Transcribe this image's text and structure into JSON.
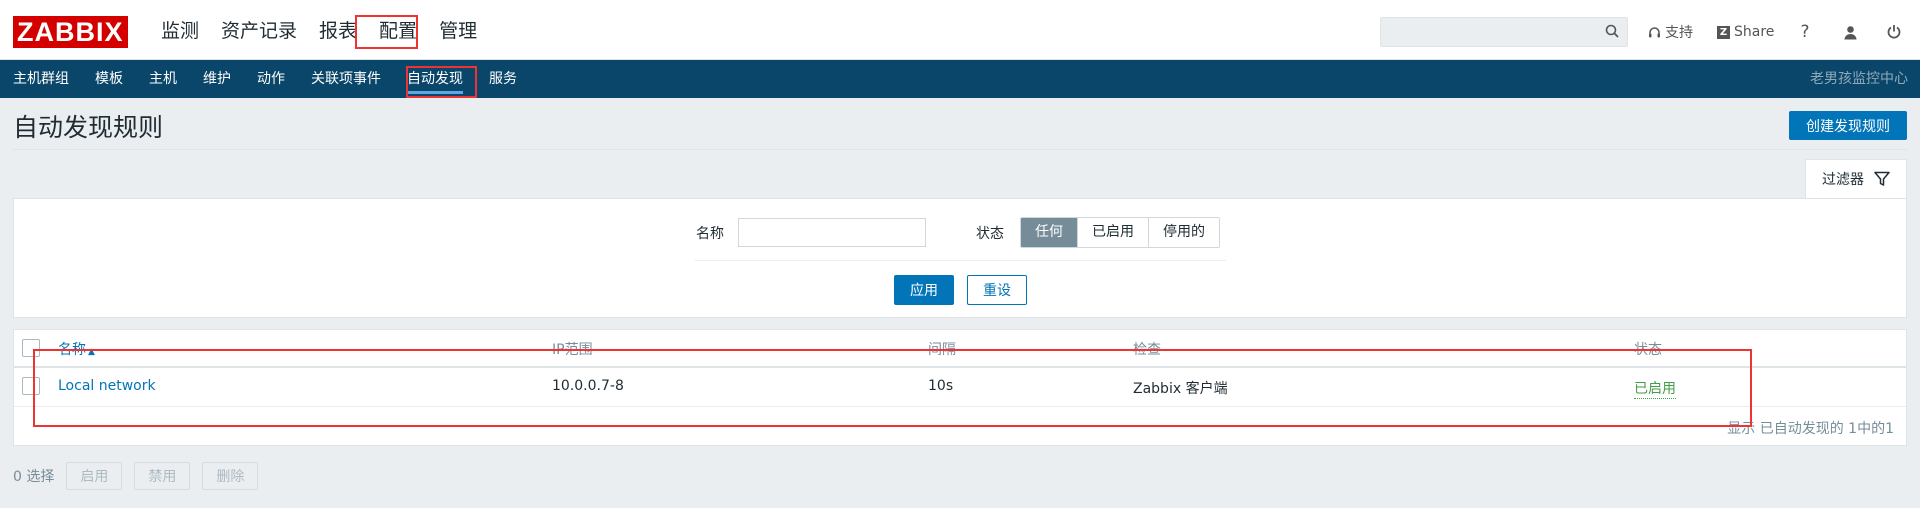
{
  "logo": "ZABBIX",
  "main_menu": [
    {
      "label": "监测"
    },
    {
      "label": "资产记录"
    },
    {
      "label": "报表"
    },
    {
      "label": "配置"
    },
    {
      "label": "管理"
    }
  ],
  "search": {
    "placeholder": "",
    "value": ""
  },
  "top_links": {
    "support": "支持",
    "share": "Share",
    "help": "?"
  },
  "sub_menu": [
    {
      "label": "主机群组"
    },
    {
      "label": "模板"
    },
    {
      "label": "主机"
    },
    {
      "label": "维护"
    },
    {
      "label": "动作"
    },
    {
      "label": "关联项事件"
    },
    {
      "label": "自动发现"
    },
    {
      "label": "服务"
    }
  ],
  "server_name": "老男孩监控中心",
  "page": {
    "title": "自动发现规则",
    "create_button": "创建发现规则"
  },
  "filter": {
    "tab_label": "过滤器",
    "name_label": "名称",
    "name_value": "",
    "status_label": "状态",
    "status_options": [
      "任何",
      "已启用",
      "停用的"
    ],
    "status_selected": "任何",
    "apply": "应用",
    "reset": "重设"
  },
  "table": {
    "headers": {
      "name": "名称",
      "ip_range": "IP范围",
      "interval": "间隔",
      "checks": "检查",
      "status": "状态"
    },
    "sort_indicator": "▲",
    "rows": [
      {
        "name": "Local network",
        "ip_range": "10.0.0.7-8",
        "interval": "10s",
        "checks": "Zabbix 客户端",
        "status": "已启用"
      }
    ],
    "paging": "显示 已自动发现的 1中的1"
  },
  "mass_actions": {
    "selected": "0 选择",
    "enable": "启用",
    "disable": "禁用",
    "delete": "删除"
  },
  "colors": {
    "brand_red": "#d40000",
    "nav_blue": "#0a466a",
    "primary": "#0275b8",
    "enabled_green": "#429e47",
    "annotation_red": "#e33333"
  }
}
